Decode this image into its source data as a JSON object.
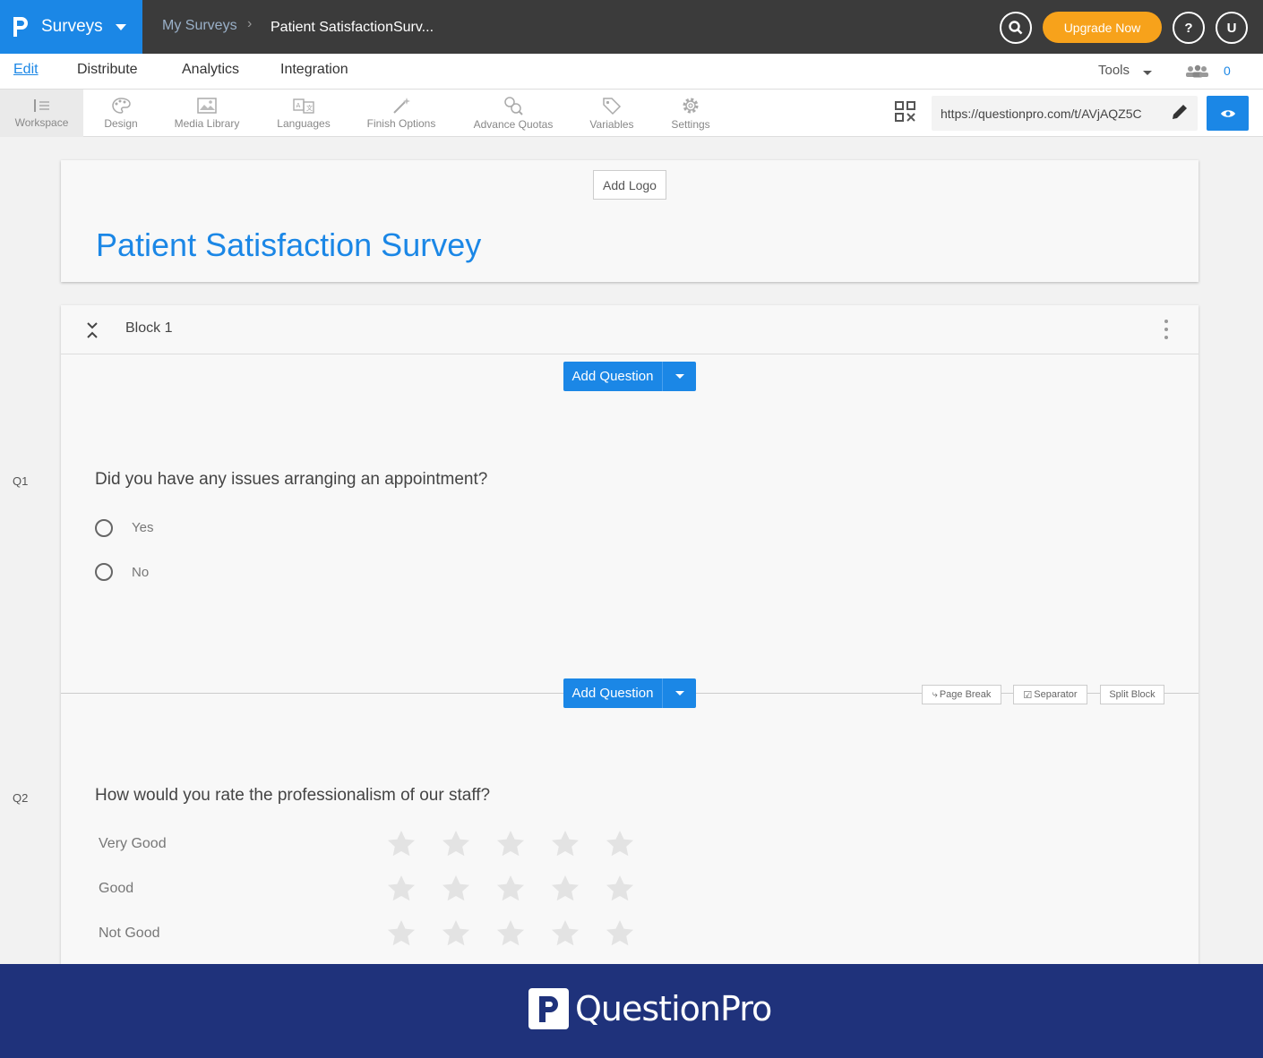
{
  "app": {
    "product_name": "Surveys",
    "breadcrumb": [
      "My Surveys",
      "Patient SatisfactionSurv..."
    ],
    "upgrade_label": "Upgrade Now",
    "help_label": "?",
    "user_initial": "U"
  },
  "menu": {
    "items": [
      "Edit",
      "Distribute",
      "Analytics",
      "Integration"
    ],
    "active": "Edit",
    "tools_label": "Tools",
    "collaborators_count": "0"
  },
  "toolbar": {
    "tools": [
      "Workspace",
      "Design",
      "Media Library",
      "Languages",
      "Finish Options",
      "Advance Quotas",
      "Variables",
      "Settings"
    ],
    "survey_url": "https://questionpro.com/t/AVjAQZ5C"
  },
  "survey": {
    "add_logo_label": "Add Logo",
    "title": "Patient Satisfaction Survey",
    "block_name": "Block 1",
    "add_question_label": "Add Question",
    "divider_actions": [
      "Page Break",
      "Separator",
      "Split Block"
    ],
    "questions": [
      {
        "number": "Q1",
        "text": "Did you have any issues arranging an appointment?",
        "options": [
          "Yes",
          "No"
        ]
      },
      {
        "number": "Q2",
        "text": "How would you rate the professionalism of our staff?",
        "rows": [
          "Very Good",
          "Good",
          "Not Good"
        ],
        "stars_per_row": 5
      }
    ]
  },
  "footer": {
    "brand": "QuestionPro"
  },
  "colors": {
    "brand_blue": "#1b87e6",
    "upgrade_orange": "#f7a21b",
    "footer_navy": "#1f327b",
    "topbar_dark": "#3b3b3b"
  }
}
